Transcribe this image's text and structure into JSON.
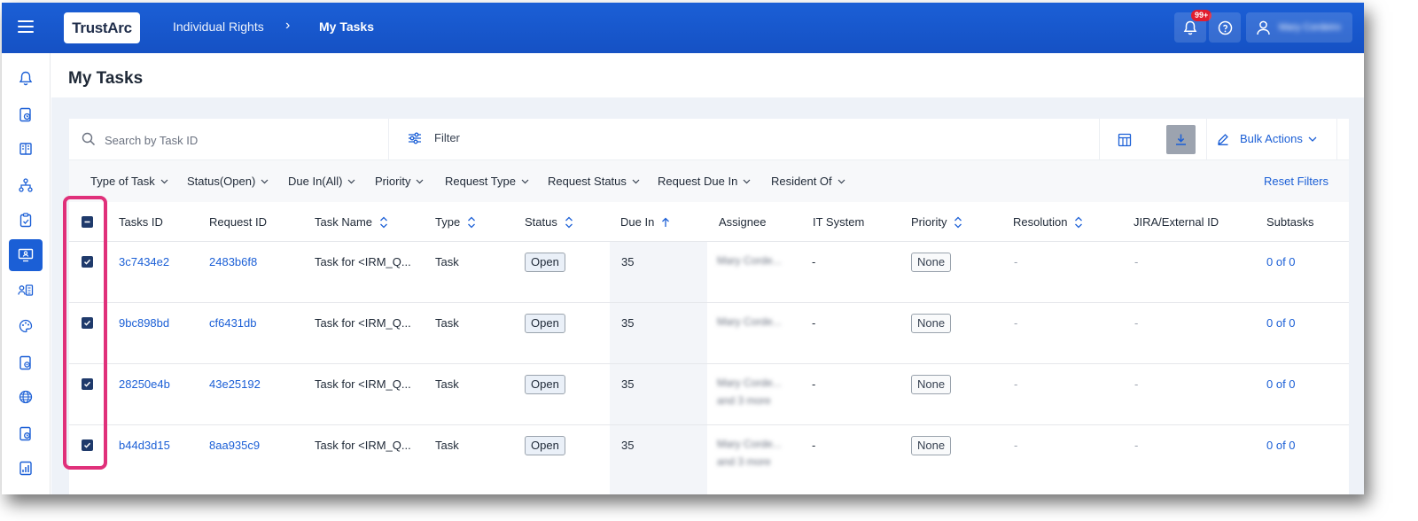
{
  "app": {
    "logo": "TrustArc"
  },
  "breadcrumb": {
    "parent": "Individual Rights",
    "separator": "›",
    "current": "My Tasks"
  },
  "header": {
    "notification_badge": "99+",
    "user_name": "Mary Cordeiro"
  },
  "page": {
    "title": "My Tasks"
  },
  "toolbar": {
    "search_placeholder": "Search by Task ID",
    "filter_label": "Filter",
    "bulk_actions_label": "Bulk Actions"
  },
  "filters": {
    "chips": [
      "Type of Task",
      "Status(Open)",
      "Due In(All)",
      "Priority",
      "Request Type",
      "Request Status",
      "Request Due In",
      "Resident Of"
    ],
    "reset_label": "Reset Filters"
  },
  "table": {
    "columns": [
      "Tasks ID",
      "Request ID",
      "Task Name",
      "Type",
      "Status",
      "Due In",
      "Assignee",
      "IT System",
      "Priority",
      "Resolution",
      "JIRA/External ID",
      "Subtasks"
    ],
    "rows": [
      {
        "task_id": "3c7434e2",
        "request_id": "2483b6f8",
        "task_name": "Task for <IRM_Q...",
        "type": "Task",
        "status": "Open",
        "due_in": "35",
        "assignee": "Mary Corde...",
        "assignee_more": "",
        "it_system": "-",
        "priority": "None",
        "resolution": "-",
        "jira": "-",
        "subtasks": "0 of 0"
      },
      {
        "task_id": "9bc898bd",
        "request_id": "cf6431db",
        "task_name": "Task for <IRM_Q...",
        "type": "Task",
        "status": "Open",
        "due_in": "35",
        "assignee": "Mary Corde...",
        "assignee_more": "",
        "it_system": "-",
        "priority": "None",
        "resolution": "-",
        "jira": "-",
        "subtasks": "0 of 0"
      },
      {
        "task_id": "28250e4b",
        "request_id": "43e25192",
        "task_name": "Task for <IRM_Q...",
        "type": "Task",
        "status": "Open",
        "due_in": "35",
        "assignee": "Mary Corde...",
        "assignee_more": "and 3 more",
        "it_system": "-",
        "priority": "None",
        "resolution": "-",
        "jira": "-",
        "subtasks": "0 of 0"
      },
      {
        "task_id": "b44d3d15",
        "request_id": "8aa935c9",
        "task_name": "Task for <IRM_Q...",
        "type": "Task",
        "status": "Open",
        "due_in": "35",
        "assignee": "Mary Corde...",
        "assignee_more": "and 3 more",
        "it_system": "-",
        "priority": "None",
        "resolution": "-",
        "jira": "-",
        "subtasks": "0 of 0"
      }
    ]
  },
  "colors": {
    "brand": "#1b5fd6",
    "highlight": "#e0307a",
    "checkbox": "#1f3a6b"
  },
  "icons": {
    "sidebar": [
      "bell-icon",
      "clock-doc-icon",
      "book-icon",
      "network-icon",
      "clipboard-check-icon",
      "monitor-user-icon",
      "user-list-icon",
      "palette-icon",
      "doc-settings-icon",
      "globe-icon",
      "doc-clock-icon",
      "report-icon"
    ]
  }
}
